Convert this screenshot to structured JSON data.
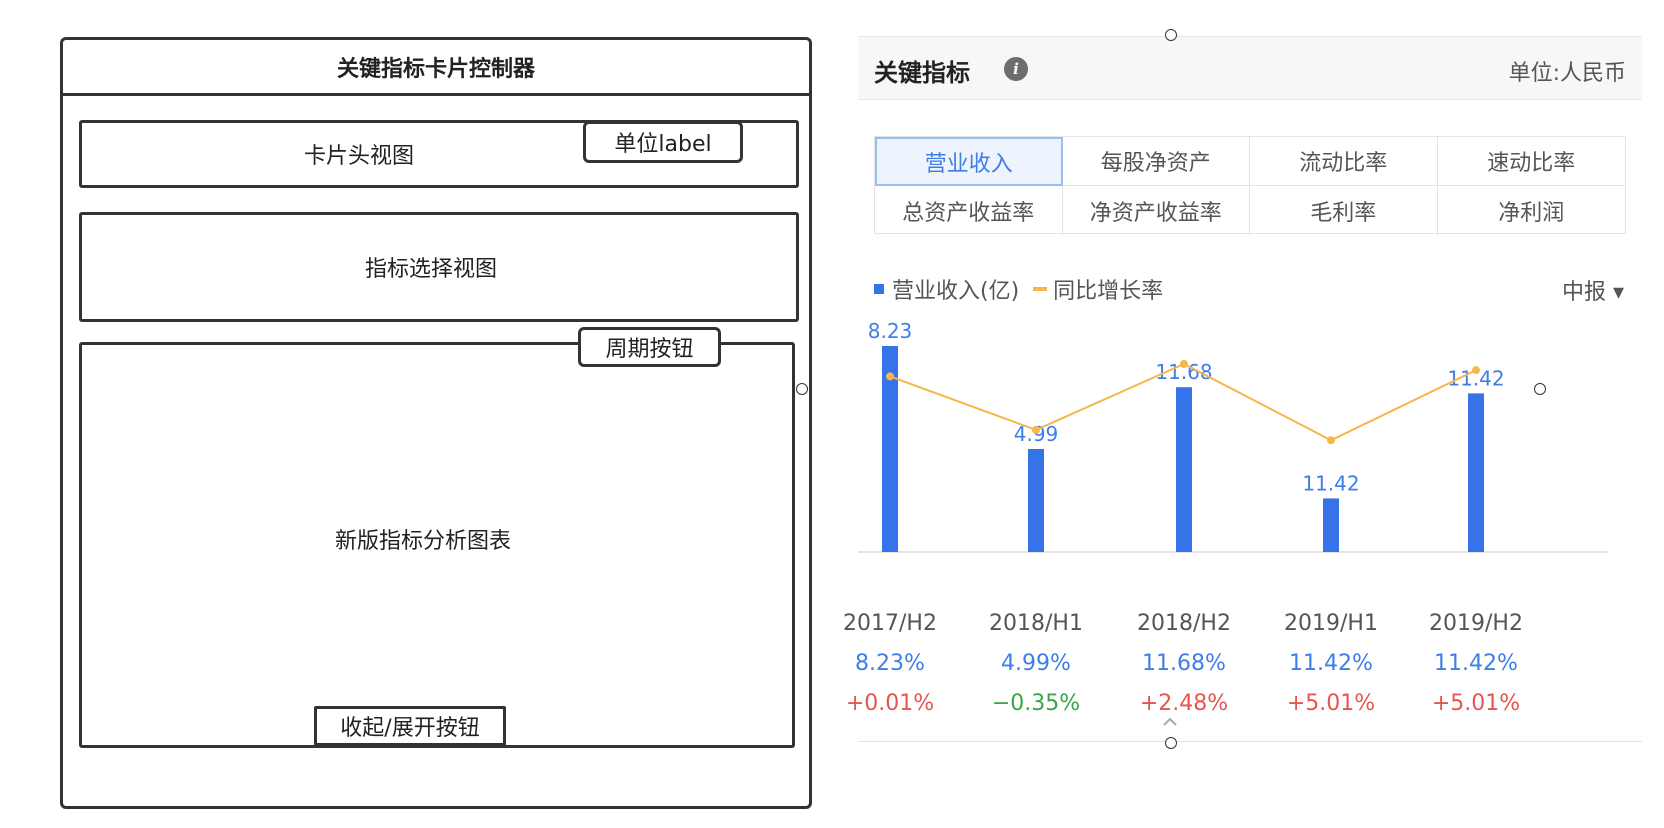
{
  "wireframe": {
    "title": "关键指标卡片控制器",
    "header_view": "卡片头视图",
    "unit_label_button": "单位label",
    "selector_view": "指标选择视图",
    "period_button": "周期按钮",
    "chart_view": "新版指标分析图表",
    "collapse_button": "收起/展开按钮"
  },
  "card": {
    "title": "关键指标",
    "info_icon": "info-icon",
    "unit": "单位:人民币",
    "tabs": [
      "营业收入",
      "每股净资产",
      "流动比率",
      "速动比率",
      "总资产收益率",
      "净资产收益率",
      "毛利率",
      "净利润"
    ],
    "active_tab": "营业收入",
    "legend_bar": "营业收入(亿)",
    "legend_line": "同比增长率",
    "period_select": "中报 ▾",
    "collapse_icon": "chevron-up-icon",
    "columns": [
      {
        "period": "2017/H2",
        "value": "8.23%",
        "change": "+0.01%",
        "trend": "pos"
      },
      {
        "period": "2018/H1",
        "value": "4.99%",
        "change": "−0.35%",
        "trend": "neg"
      },
      {
        "period": "2018/H2",
        "value": "11.68%",
        "change": "+2.48%",
        "trend": "pos"
      },
      {
        "period": "2019/H1",
        "value": "11.42%",
        "change": "+5.01%",
        "trend": "pos"
      },
      {
        "period": "2019/H2",
        "value": "11.42%",
        "change": "+5.01%",
        "trend": "pos"
      }
    ],
    "colors": {
      "bar": "#3673e8",
      "line": "#f6b64a",
      "accent": "#3f7de8",
      "positive": "#e8544e",
      "negative": "#3aa545"
    }
  },
  "chart_data": {
    "type": "bar",
    "categories": [
      "2017/H2",
      "2018/H1",
      "2018/H2",
      "2019/H1",
      "2019/H2"
    ],
    "series": [
      {
        "name": "营业收入(亿)",
        "type": "bar",
        "values": [
          8.23,
          4.99,
          11.68,
          11.42,
          11.42
        ],
        "labels": [
          "8.23",
          "4.99",
          "11.68",
          "11.42",
          "11.42"
        ],
        "relative_heights": [
          1.0,
          0.5,
          0.8,
          0.26,
          0.77
        ]
      },
      {
        "name": "同比增长率",
        "type": "line",
        "relative_values": [
          0.94,
          0.68,
          1.0,
          0.63,
          0.97
        ]
      }
    ],
    "legend": "top-left",
    "grid": false
  }
}
